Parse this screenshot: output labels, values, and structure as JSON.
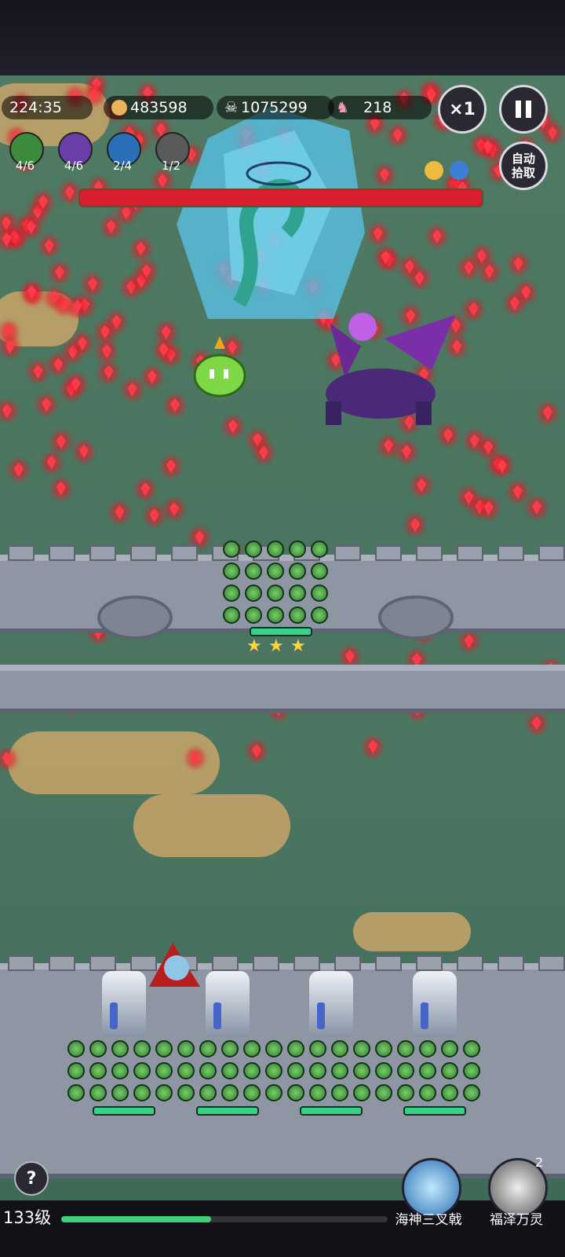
{
  "hud": {
    "timer": "224:35",
    "gold": "483598",
    "kills": "1075299",
    "enemies": "218",
    "speed_label": "×1",
    "auto_pickup_label": "自动\n拾取"
  },
  "skills": [
    {
      "icon": "sword-skill-icon",
      "count": "4/6",
      "color": "#3c8a3c"
    },
    {
      "icon": "purple-ring-skill-icon",
      "count": "4/6",
      "color": "#6a3fa8"
    },
    {
      "icon": "blue-whirl-skill-icon",
      "count": "2/4",
      "color": "#2a6fb8"
    },
    {
      "icon": "gray-claw-skill-icon",
      "count": "1/2",
      "color": "#5a5a5a"
    }
  ],
  "status_icons": [
    "sword-buff-icon",
    "magnet-buff-icon"
  ],
  "boss": {
    "hp_fraction": 1.0
  },
  "upgrade_stars": 3,
  "bottom": {
    "level_label": "133级",
    "xp_fraction": 0.46,
    "abilities": [
      {
        "name": "海神三叉戟",
        "icon": "trident-ability-icon"
      },
      {
        "name": "福泽万灵",
        "icon": "spirit-ability-icon",
        "badge": "2"
      }
    ]
  },
  "colors": {
    "gem": "#ff3b4a",
    "hp_boss": "#d81f2e",
    "xp": "#3fd07a"
  }
}
